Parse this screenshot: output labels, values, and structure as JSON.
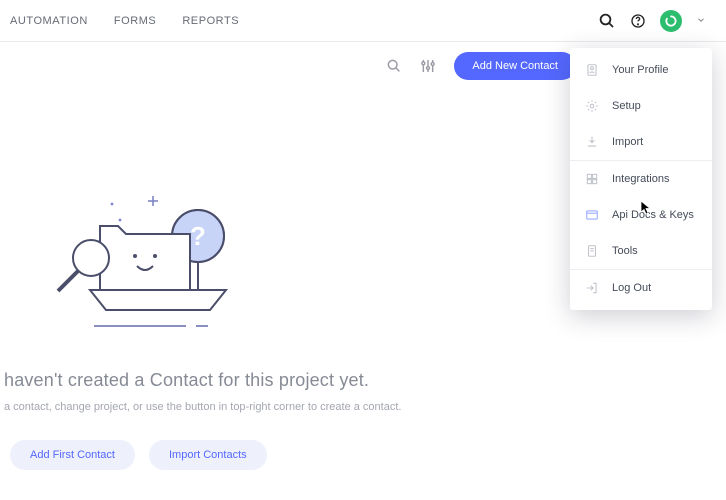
{
  "nav": {
    "tabs": [
      "AUTOMATION",
      "FORMS",
      "REPORTS"
    ]
  },
  "toolbar": {
    "add_button": "Add New Contact"
  },
  "dropdown": {
    "items": [
      {
        "label": "Your Profile"
      },
      {
        "label": "Setup"
      },
      {
        "label": "Import"
      },
      {
        "label": "Integrations"
      },
      {
        "label": "Api Docs & Keys"
      },
      {
        "label": "Tools"
      },
      {
        "label": "Log Out"
      }
    ]
  },
  "empty_state": {
    "heading": "haven't created a Contact for this project yet.",
    "sub": "a contact, change project, or use the button in top-right corner to create a contact."
  },
  "buttons": {
    "add_first": "Add First Contact",
    "import_contacts": "Import Contacts"
  },
  "colors": {
    "accent": "#5468ff",
    "green": "#2dbd6e",
    "highlight": "#ff0000"
  }
}
